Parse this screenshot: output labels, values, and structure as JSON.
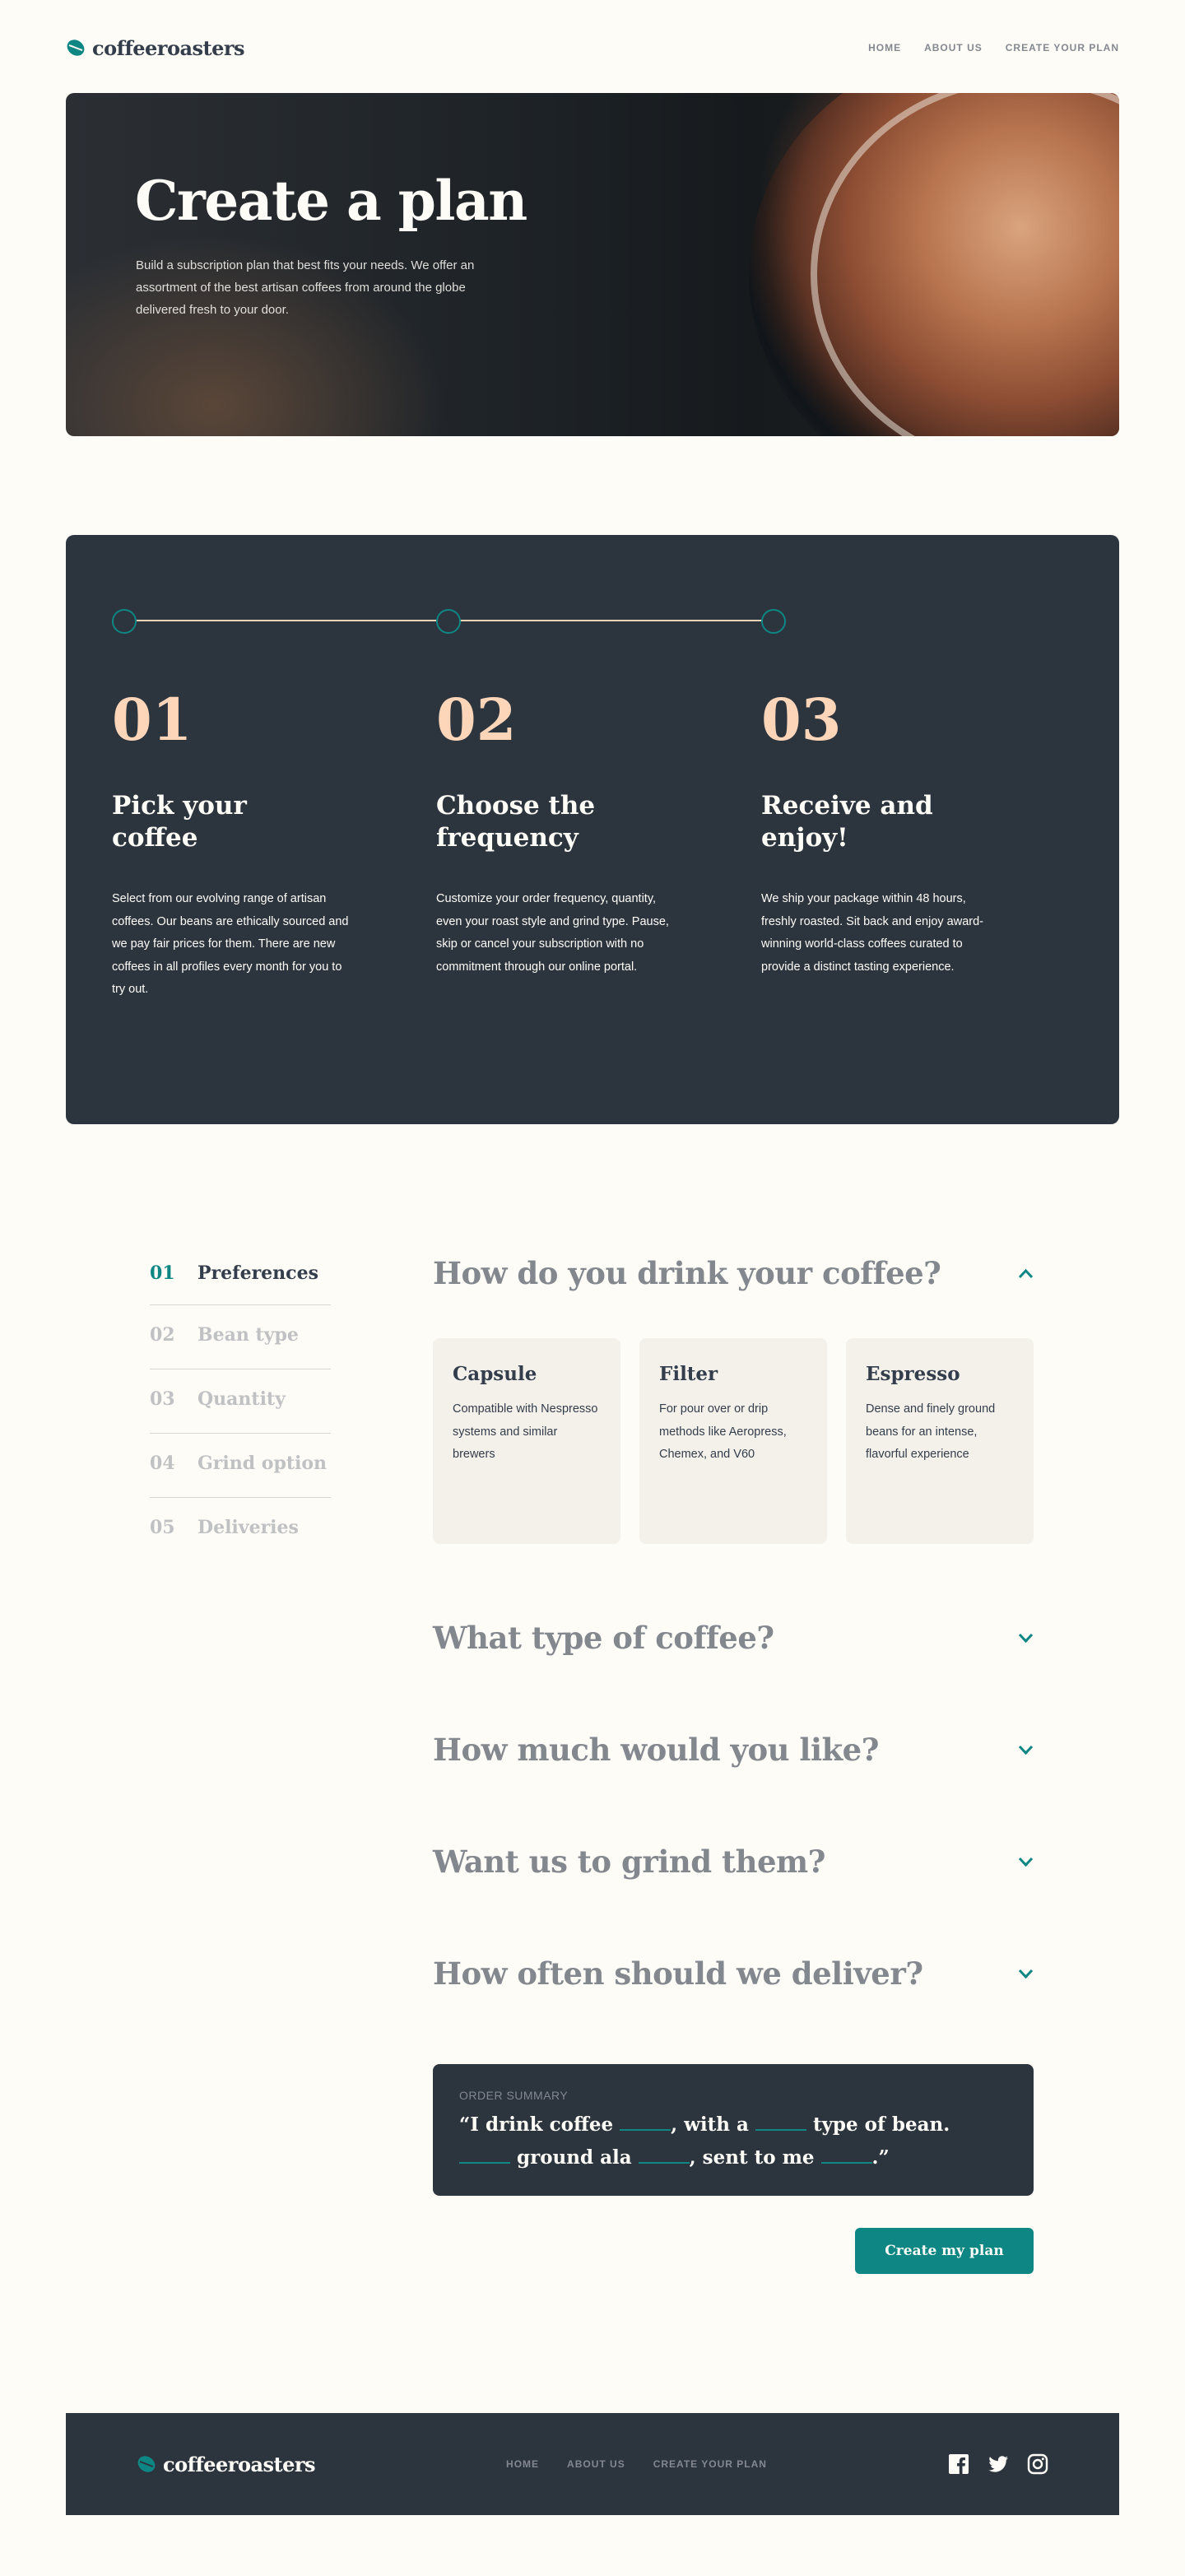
{
  "header": {
    "logo": "coffeeroasters",
    "nav": [
      "HOME",
      "ABOUT US",
      "CREATE YOUR PLAN"
    ]
  },
  "hero": {
    "title": "Create a plan",
    "text": "Build a subscription plan that best fits your needs. We offer an assortment of the best artisan coffees from around the globe delivered fresh to your door."
  },
  "steps": [
    {
      "num": "01",
      "title": "Pick your coffee",
      "text": "Select from our evolving range of artisan coffees. Our beans are ethically sourced and we pay fair prices for them. There are new coffees in all profiles every month for you to try out."
    },
    {
      "num": "02",
      "title": "Choose the frequency",
      "text": "Customize your order frequency, quantity, even your roast style and grind type. Pause, skip or cancel your subscription with no commitment through our online portal."
    },
    {
      "num": "03",
      "title": "Receive and enjoy!",
      "text": "We ship your package within 48 hours, freshly roasted. Sit back and enjoy award-winning world-class coffees curated to provide a distinct tasting experience."
    }
  ],
  "sidebar": {
    "items": [
      {
        "num": "01",
        "label": "Preferences"
      },
      {
        "num": "02",
        "label": "Bean type"
      },
      {
        "num": "03",
        "label": "Quantity"
      },
      {
        "num": "04",
        "label": "Grind option"
      },
      {
        "num": "05",
        "label": "Deliveries"
      }
    ]
  },
  "questions": [
    "How do you drink your coffee?",
    "What type of coffee?",
    "How much would you like?",
    "Want us to grind them?",
    "How often should we deliver?"
  ],
  "options": [
    {
      "title": "Capsule",
      "text": "Compatible with Nespresso systems and similar brewers"
    },
    {
      "title": "Filter",
      "text": "For pour over or drip methods like Aeropress, Chemex, and V60"
    },
    {
      "title": "Espresso",
      "text": "Dense and finely ground beans for an intense, flavorful experience"
    }
  ],
  "summary": {
    "label": "ORDER SUMMARY",
    "p1": "“I drink coffee ",
    "p2": ", with a ",
    "p3": " type of bean.",
    "p4": " ground ala ",
    "p5": ", sent to me ",
    "p6": ".”"
  },
  "cta": "Create my plan",
  "footer": {
    "logo": "coffeeroasters",
    "nav": [
      "HOME",
      "ABOUT US",
      "CREATE YOUR PLAN"
    ],
    "social": [
      "facebook-icon",
      "twitter-icon",
      "instagram-icon"
    ]
  },
  "colors": {
    "accent": "#0E8784",
    "dark": "#2C343E",
    "peach": "#FDD6BA",
    "background": "#FEFCF7",
    "muted": "#83888F"
  }
}
